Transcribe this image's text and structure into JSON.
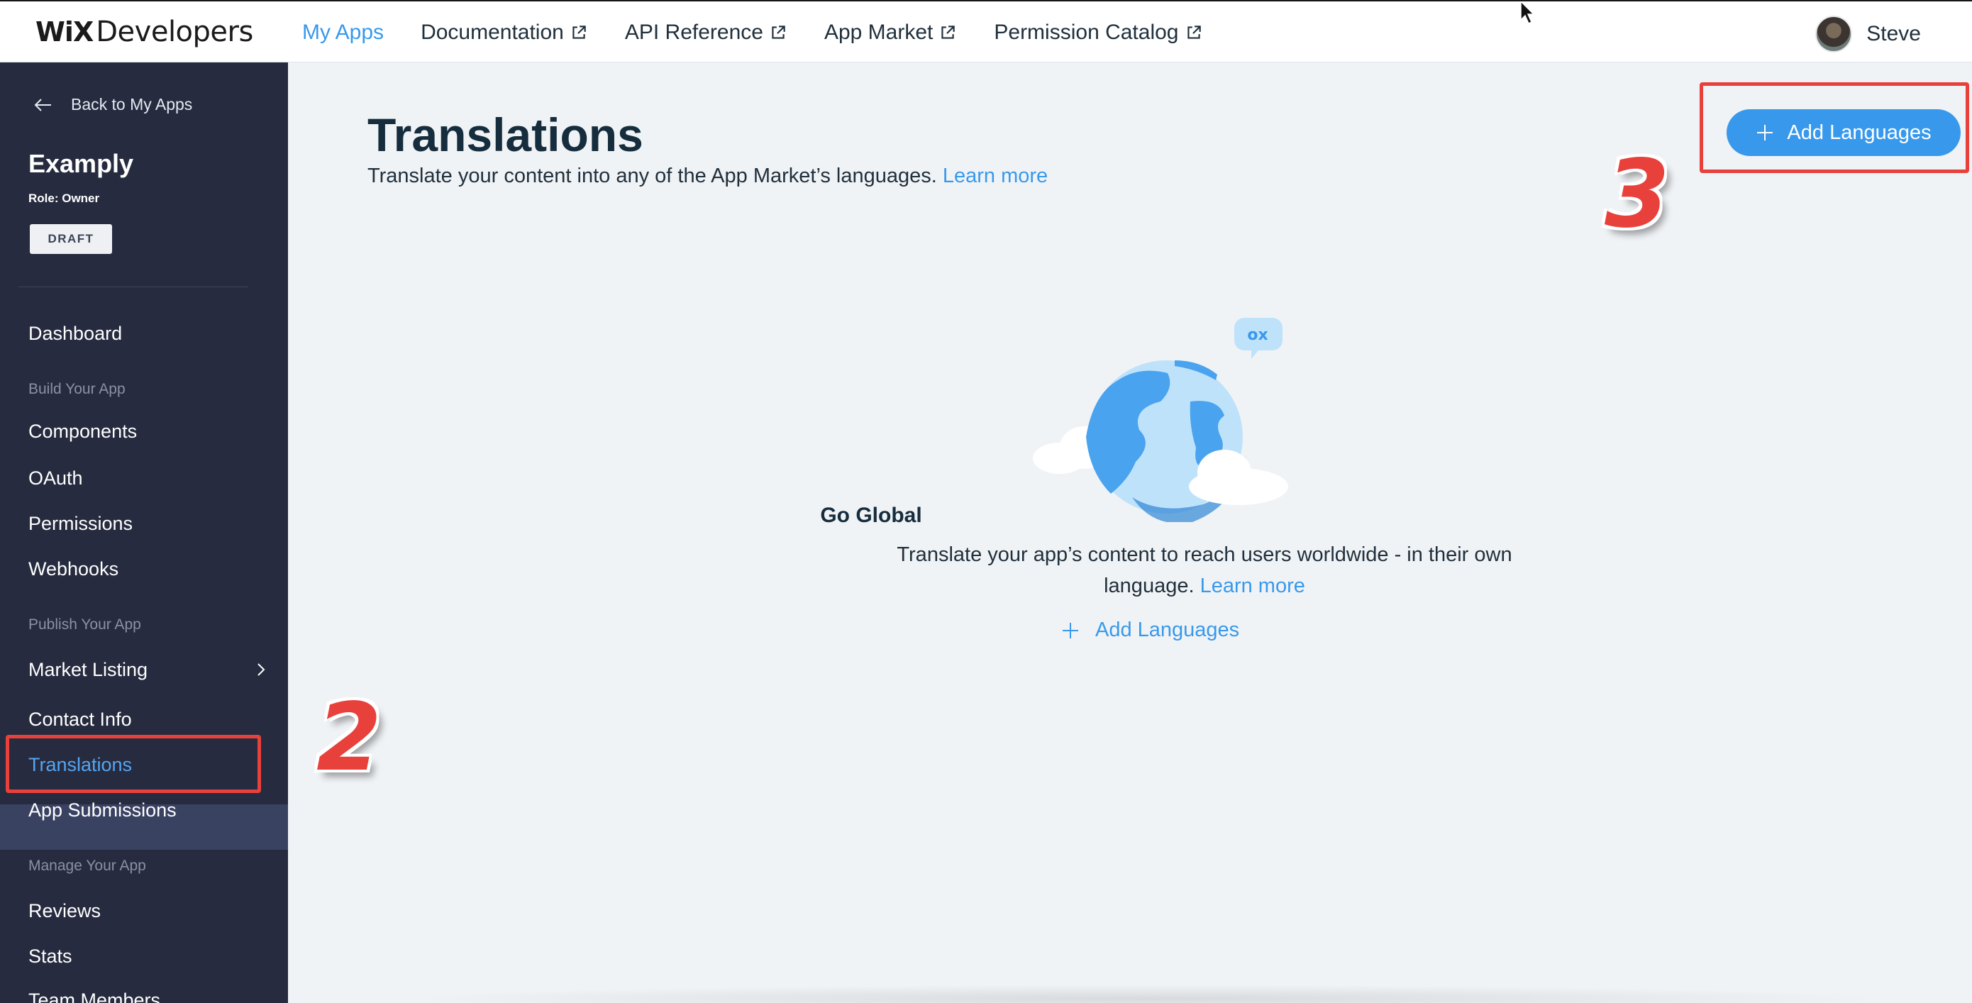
{
  "topbar": {
    "logo_wix": "WiX",
    "logo_dev": "Developers",
    "nav": [
      {
        "label": "My Apps"
      },
      {
        "label": "Documentation"
      },
      {
        "label": "API Reference"
      },
      {
        "label": "App Market"
      },
      {
        "label": "Permission Catalog"
      }
    ],
    "user_name": "Steve"
  },
  "sidebar": {
    "back_label": "Back to My Apps",
    "app_name": "Examply",
    "role": "Role: Owner",
    "status_badge": "DRAFT",
    "items": {
      "dashboard": "Dashboard",
      "section_build": "Build Your App",
      "components": "Components",
      "oauth": "OAuth",
      "permissions": "Permissions",
      "webhooks": "Webhooks",
      "section_publish": "Publish Your App",
      "market_listing": "Market Listing",
      "contact_info": "Contact Info",
      "translations": "Translations",
      "app_submissions": "App Submissions",
      "section_manage": "Manage Your App",
      "reviews": "Reviews",
      "stats": "Stats",
      "team_members": "Team Members"
    }
  },
  "main": {
    "title": "Translations",
    "subtitle": "Translate your content into any of the App Market’s languages.",
    "subtitle_link": "Learn more",
    "add_button": "Add Languages",
    "empty": {
      "bubble_text": "ox",
      "title": "Go Global",
      "text_line1": "Translate your app’s content to reach users worldwide - in their own",
      "text_line2": "language.",
      "link": "Learn more",
      "add_label": "Add Languages"
    }
  },
  "annotations": {
    "step_2": "2",
    "step_3": "3",
    "color": "#e8413c"
  },
  "colors": {
    "accent": "#3899ec",
    "sidebar_bg": "#262b3f",
    "main_bg": "#f0f3f6"
  }
}
